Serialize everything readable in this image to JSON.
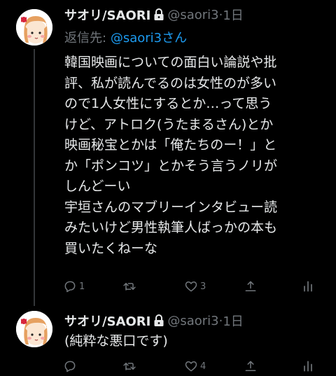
{
  "tweets": [
    {
      "display_name": "サオリ/SAORI",
      "handle": "@saori3",
      "separator": "·",
      "time": "1日",
      "reply_to_label": "返信先:",
      "reply_to_handle": "@saori3さん",
      "text": "韓国映画についての面白い論説や批\n評、私が読んでるのは女性のが多い\nので1人女性にするとか…って思う\nけど、アトロク(うたまるさん)とか\n映画秘宝とかは「俺たちのー！」と\nか「ポンコツ」とかそう言うノリが\nしんどーい\n宇垣さんのマブリーインタビュー読\nみたいけど男性執筆人ばっかの本も\n買いたくねーな",
      "reply_count": "1",
      "retweet_count": "",
      "like_count": "3"
    },
    {
      "display_name": "サオリ/SAORI",
      "handle": "@saori3",
      "separator": "·",
      "time": "1日",
      "text": "(純粋な悪口です)",
      "reply_count": "",
      "retweet_count": "",
      "like_count": "4"
    }
  ],
  "colors": {
    "background": "#000000",
    "text": "#e7e9ea",
    "secondary": "#71767b",
    "accent": "#1d9bf0"
  }
}
